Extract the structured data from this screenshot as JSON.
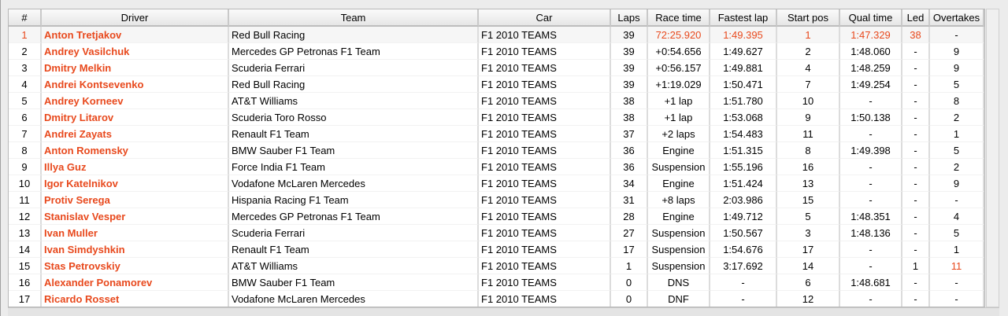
{
  "colors": {
    "highlight": "#e8491d"
  },
  "columns": [
    "#",
    "Driver",
    "Team",
    "Car",
    "Laps",
    "Race time",
    "Fastest lap",
    "Start pos",
    "Qual time",
    "Led",
    "Overtakes"
  ],
  "rows": [
    {
      "pos": "1",
      "driver": "Anton Tretjakov",
      "team": "Red Bull Racing",
      "car": "F1 2010 TEAMS",
      "laps": "39",
      "race_time": "72:25.920",
      "fastest_lap": "1:49.395",
      "start_pos": "1",
      "qual_time": "1:47.329",
      "led": "38",
      "overtakes": "-"
    },
    {
      "pos": "2",
      "driver": "Andrey Vasilchuk",
      "team": "Mercedes GP Petronas F1 Team",
      "car": "F1 2010 TEAMS",
      "laps": "39",
      "race_time": "+0:54.656",
      "fastest_lap": "1:49.627",
      "start_pos": "2",
      "qual_time": "1:48.060",
      "led": "-",
      "overtakes": "9"
    },
    {
      "pos": "3",
      "driver": "Dmitry Melkin",
      "team": "Scuderia Ferrari",
      "car": "F1 2010 TEAMS",
      "laps": "39",
      "race_time": "+0:56.157",
      "fastest_lap": "1:49.881",
      "start_pos": "4",
      "qual_time": "1:48.259",
      "led": "-",
      "overtakes": "9"
    },
    {
      "pos": "4",
      "driver": "Andrei Kontsevenko",
      "team": "Red Bull Racing",
      "car": "F1 2010 TEAMS",
      "laps": "39",
      "race_time": "+1:19.029",
      "fastest_lap": "1:50.471",
      "start_pos": "7",
      "qual_time": "1:49.254",
      "led": "-",
      "overtakes": "5"
    },
    {
      "pos": "5",
      "driver": "Andrey Korneev",
      "team": "AT&T Williams",
      "car": "F1 2010 TEAMS",
      "laps": "38",
      "race_time": "+1 lap",
      "fastest_lap": "1:51.780",
      "start_pos": "10",
      "qual_time": "-",
      "led": "-",
      "overtakes": "8"
    },
    {
      "pos": "6",
      "driver": "Dmitry Litarov",
      "team": "Scuderia Toro Rosso",
      "car": "F1 2010 TEAMS",
      "laps": "38",
      "race_time": "+1 lap",
      "fastest_lap": "1:53.068",
      "start_pos": "9",
      "qual_time": "1:50.138",
      "led": "-",
      "overtakes": "2"
    },
    {
      "pos": "7",
      "driver": "Andrei Zayats",
      "team": "Renault F1 Team",
      "car": "F1 2010 TEAMS",
      "laps": "37",
      "race_time": "+2 laps",
      "fastest_lap": "1:54.483",
      "start_pos": "11",
      "qual_time": "-",
      "led": "-",
      "overtakes": "1"
    },
    {
      "pos": "8",
      "driver": "Anton Romensky",
      "team": "BMW Sauber F1 Team",
      "car": "F1 2010 TEAMS",
      "laps": "36",
      "race_time": "Engine",
      "fastest_lap": "1:51.315",
      "start_pos": "8",
      "qual_time": "1:49.398",
      "led": "-",
      "overtakes": "5"
    },
    {
      "pos": "9",
      "driver": "Illya Guz",
      "team": "Force India F1 Team",
      "car": "F1 2010 TEAMS",
      "laps": "36",
      "race_time": "Suspension",
      "fastest_lap": "1:55.196",
      "start_pos": "16",
      "qual_time": "-",
      "led": "-",
      "overtakes": "2"
    },
    {
      "pos": "10",
      "driver": "Igor Katelnikov",
      "team": "Vodafone McLaren Mercedes",
      "car": "F1 2010 TEAMS",
      "laps": "34",
      "race_time": "Engine",
      "fastest_lap": "1:51.424",
      "start_pos": "13",
      "qual_time": "-",
      "led": "-",
      "overtakes": "9"
    },
    {
      "pos": "11",
      "driver": "Protiv Serega",
      "team": "Hispania Racing F1 Team",
      "car": "F1 2010 TEAMS",
      "laps": "31",
      "race_time": "+8 laps",
      "fastest_lap": "2:03.986",
      "start_pos": "15",
      "qual_time": "-",
      "led": "-",
      "overtakes": "-"
    },
    {
      "pos": "12",
      "driver": "Stanislav Vesper",
      "team": "Mercedes GP Petronas F1 Team",
      "car": "F1 2010 TEAMS",
      "laps": "28",
      "race_time": "Engine",
      "fastest_lap": "1:49.712",
      "start_pos": "5",
      "qual_time": "1:48.351",
      "led": "-",
      "overtakes": "4"
    },
    {
      "pos": "13",
      "driver": "Ivan Muller",
      "team": "Scuderia Ferrari",
      "car": "F1 2010 TEAMS",
      "laps": "27",
      "race_time": "Suspension",
      "fastest_lap": "1:50.567",
      "start_pos": "3",
      "qual_time": "1:48.136",
      "led": "-",
      "overtakes": "5"
    },
    {
      "pos": "14",
      "driver": "Ivan Simdyshkin",
      "team": "Renault F1 Team",
      "car": "F1 2010 TEAMS",
      "laps": "17",
      "race_time": "Suspension",
      "fastest_lap": "1:54.676",
      "start_pos": "17",
      "qual_time": "-",
      "led": "-",
      "overtakes": "1"
    },
    {
      "pos": "15",
      "driver": "Stas Petrovskiy",
      "team": "AT&T Williams",
      "car": "F1 2010 TEAMS",
      "laps": "1",
      "race_time": "Suspension",
      "fastest_lap": "3:17.692",
      "start_pos": "14",
      "qual_time": "-",
      "led": "1",
      "overtakes": "11"
    },
    {
      "pos": "16",
      "driver": "Alexander Ponamorev",
      "team": "BMW Sauber F1 Team",
      "car": "F1 2010 TEAMS",
      "laps": "0",
      "race_time": "DNS",
      "fastest_lap": "-",
      "start_pos": "6",
      "qual_time": "1:48.681",
      "led": "-",
      "overtakes": "-"
    },
    {
      "pos": "17",
      "driver": "Ricardo Rosset",
      "team": "Vodafone McLaren Mercedes",
      "car": "F1 2010 TEAMS",
      "laps": "0",
      "race_time": "DNF",
      "fastest_lap": "-",
      "start_pos": "12",
      "qual_time": "-",
      "led": "-",
      "overtakes": "-"
    }
  ],
  "highlighted_cells": {
    "0": [
      "pos",
      "race_time",
      "fastest_lap",
      "start_pos",
      "qual_time",
      "led"
    ],
    "14": [
      "overtakes"
    ]
  }
}
